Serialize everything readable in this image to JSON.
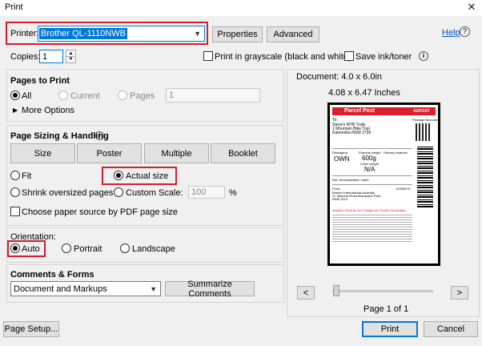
{
  "window": {
    "title": "Print",
    "close_glyph": "✕"
  },
  "printer": {
    "label": "Printer:",
    "selected": "Brother QL-1110NWB",
    "properties_button": "Properties",
    "advanced_button": "Advanced",
    "help_link": "Help",
    "help_glyph": "?"
  },
  "copies": {
    "label": "Copies:",
    "value": "1"
  },
  "options": {
    "grayscale_label": "Print in grayscale (black and white)",
    "save_ink_label": "Save ink/toner",
    "info_glyph": "i"
  },
  "pages_to_print": {
    "heading": "Pages to Print",
    "all": "All",
    "current": "Current",
    "pages": "Pages",
    "pages_value": "1",
    "more_options": "More Options",
    "more_glyph": "▶"
  },
  "sizing": {
    "heading": "Page Sizing & Handling",
    "info_glyph": "i",
    "tabs": [
      "Size",
      "Poster",
      "Multiple",
      "Booklet"
    ],
    "fit": "Fit",
    "actual_size": "Actual size",
    "shrink": "Shrink oversized pages",
    "custom_scale": "Custom Scale:",
    "custom_scale_value": "100",
    "percent": "%",
    "paper_source": "Choose paper source by PDF page size"
  },
  "orientation": {
    "heading": "Orientation:",
    "auto": "Auto",
    "portrait": "Portrait",
    "landscape": "Landscape"
  },
  "comments": {
    "heading": "Comments & Forms",
    "selected": "Document and Markups",
    "summarize_button": "Summarize Comments"
  },
  "preview": {
    "document_size": "Document: 4.0 x 6.0in",
    "paper_size": "4.08 x 6.47 Inches",
    "page_indicator": "Page 1 of 1",
    "prev_glyph": "<",
    "next_glyph": ">"
  },
  "label_preview": {
    "brand": "Parcel Post",
    "carrier": "AUPOST",
    "to_label": "To:",
    "to_name": "Steve's MTB Trails",
    "to_street": "1 Mountain Bike Trail",
    "to_city": "Katoomba NSW 2790",
    "packaging_label": "Packaging",
    "packaging_value": "OWN",
    "weight_label": "Physical weight",
    "weight_value": "600g",
    "cubic_label": "Cubic weight",
    "cubic_value": "N/A",
    "delivery_label": "Delivery features",
    "ref_label": "Ref: Demonstration Label",
    "from_label": "From:",
    "from_name": "Brother International Australia",
    "from_street": "11 Talavera Road Macquarie Park",
    "from_city": "NSW 2113",
    "warning": "Aviation Security and Dangerous Goods Declaration",
    "barcode_label": "Package Barcode",
    "id_number": "12345678"
  },
  "footer": {
    "page_setup_button": "Page Setup...",
    "print_button": "Print",
    "cancel_button": "Cancel"
  },
  "colors": {
    "highlight_red": "#d01f2f",
    "auspost_red": "#dc1e2a",
    "link_blue": "#0050c8",
    "select_blue": "#0078d7"
  }
}
